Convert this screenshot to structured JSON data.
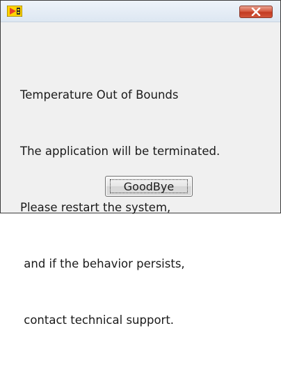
{
  "window": {
    "title_icon": "labview-app-icon",
    "close_icon": "close-icon"
  },
  "message": {
    "lines": [
      "Temperature Out of Bounds",
      "The application will be terminated.",
      "Please restart the system,",
      " and if the behavior persists,",
      " contact technical support."
    ]
  },
  "buttons": {
    "goodbye_label": "GoodBye"
  },
  "colors": {
    "close_button": "#d2553b",
    "titlebar": "#dde7f2",
    "dialog_background": "#f0f0f0"
  }
}
